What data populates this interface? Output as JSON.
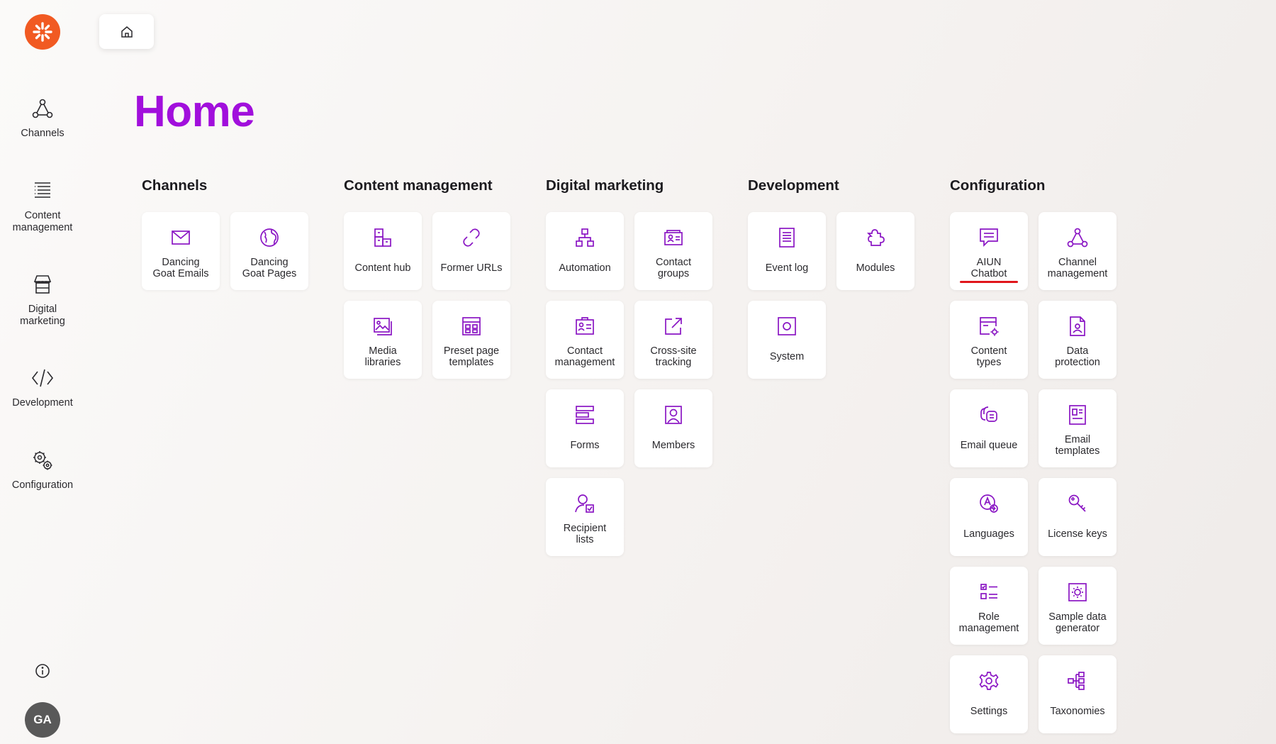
{
  "sidebar": {
    "logo": "kentico-logo-icon",
    "items": [
      {
        "label": "Channels",
        "icon": "channels-icon"
      },
      {
        "label": "Content\nmanagement",
        "icon": "content-management-icon"
      },
      {
        "label": "Digital\nmarketing",
        "icon": "digital-marketing-icon"
      },
      {
        "label": "Development",
        "icon": "code-icon"
      },
      {
        "label": "Configuration",
        "icon": "gears-icon"
      }
    ],
    "info_icon": "info-icon",
    "avatar_initials": "GA"
  },
  "header": {
    "home_icon": "home-icon"
  },
  "page": {
    "title": "Home"
  },
  "accent_color": "#a10fdc",
  "brand_color": "#f15a22",
  "sections": {
    "channels": {
      "title": "Channels",
      "tiles": [
        {
          "label": "Dancing\nGoat Emails",
          "icon": "envelope-icon"
        },
        {
          "label": "Dancing\nGoat Pages",
          "icon": "globe-icon"
        }
      ]
    },
    "content": {
      "title": "Content management",
      "tiles": [
        {
          "label": "Content hub",
          "icon": "boxes-icon"
        },
        {
          "label": "Former URLs",
          "icon": "chain-link-icon"
        },
        {
          "label": "Media\nlibraries",
          "icon": "picture-icon"
        },
        {
          "label": "Preset page\ntemplates",
          "icon": "layout-icon"
        }
      ]
    },
    "marketing": {
      "title": "Digital marketing",
      "tiles": [
        {
          "label": "Automation",
          "icon": "flowchart-icon"
        },
        {
          "label": "Contact\ngroups",
          "icon": "contact-cards-icon"
        },
        {
          "label": "Contact\nmanagement",
          "icon": "contact-card-icon"
        },
        {
          "label": "Cross-site\ntracking",
          "icon": "external-link-icon"
        },
        {
          "label": "Forms",
          "icon": "form-icon"
        },
        {
          "label": "Members",
          "icon": "member-icon"
        },
        {
          "label": "Recipient\nlists",
          "icon": "user-check-icon"
        }
      ]
    },
    "development": {
      "title": "Development",
      "tiles": [
        {
          "label": "Event log",
          "icon": "document-list-icon"
        },
        {
          "label": "Modules",
          "icon": "puzzle-icon"
        },
        {
          "label": "System",
          "icon": "system-icon"
        }
      ]
    },
    "configuration": {
      "title": "Configuration",
      "tiles": [
        {
          "label": "AIUN\nChatbot",
          "icon": "chat-bubble-icon"
        },
        {
          "label": "Channel\nmanagement",
          "icon": "channels-icon"
        },
        {
          "label": "Content\ntypes",
          "icon": "content-type-icon"
        },
        {
          "label": "Data\nprotection",
          "icon": "file-user-icon"
        },
        {
          "label": "Email queue",
          "icon": "email-queue-icon"
        },
        {
          "label": "Email\ntemplates",
          "icon": "email-template-icon"
        },
        {
          "label": "Languages",
          "icon": "language-icon"
        },
        {
          "label": "License keys",
          "icon": "key-icon"
        },
        {
          "label": "Role\nmanagement",
          "icon": "role-list-icon"
        },
        {
          "label": "Sample data\ngenerator",
          "icon": "sample-data-icon"
        },
        {
          "label": "Settings",
          "icon": "gear-icon"
        },
        {
          "label": "Taxonomies",
          "icon": "hierarchy-icon"
        }
      ]
    }
  }
}
